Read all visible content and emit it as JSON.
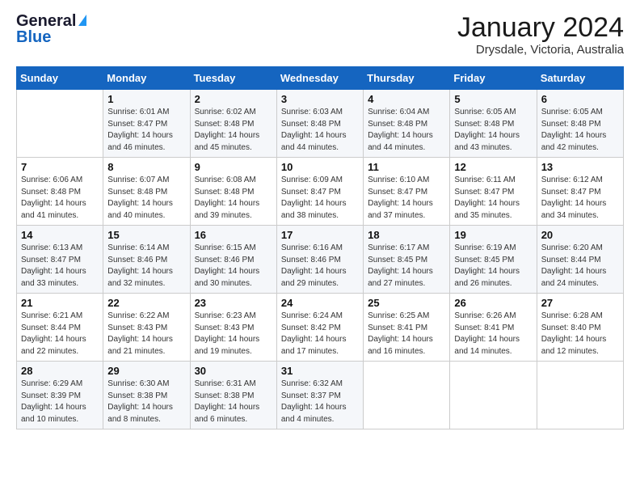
{
  "logo": {
    "line1": "General",
    "line2": "Blue"
  },
  "title": "January 2024",
  "location": "Drysdale, Victoria, Australia",
  "days_header": [
    "Sunday",
    "Monday",
    "Tuesday",
    "Wednesday",
    "Thursday",
    "Friday",
    "Saturday"
  ],
  "weeks": [
    [
      {
        "day": "",
        "info": ""
      },
      {
        "day": "1",
        "info": "Sunrise: 6:01 AM\nSunset: 8:47 PM\nDaylight: 14 hours\nand 46 minutes."
      },
      {
        "day": "2",
        "info": "Sunrise: 6:02 AM\nSunset: 8:48 PM\nDaylight: 14 hours\nand 45 minutes."
      },
      {
        "day": "3",
        "info": "Sunrise: 6:03 AM\nSunset: 8:48 PM\nDaylight: 14 hours\nand 44 minutes."
      },
      {
        "day": "4",
        "info": "Sunrise: 6:04 AM\nSunset: 8:48 PM\nDaylight: 14 hours\nand 44 minutes."
      },
      {
        "day": "5",
        "info": "Sunrise: 6:05 AM\nSunset: 8:48 PM\nDaylight: 14 hours\nand 43 minutes."
      },
      {
        "day": "6",
        "info": "Sunrise: 6:05 AM\nSunset: 8:48 PM\nDaylight: 14 hours\nand 42 minutes."
      }
    ],
    [
      {
        "day": "7",
        "info": "Sunrise: 6:06 AM\nSunset: 8:48 PM\nDaylight: 14 hours\nand 41 minutes."
      },
      {
        "day": "8",
        "info": "Sunrise: 6:07 AM\nSunset: 8:48 PM\nDaylight: 14 hours\nand 40 minutes."
      },
      {
        "day": "9",
        "info": "Sunrise: 6:08 AM\nSunset: 8:48 PM\nDaylight: 14 hours\nand 39 minutes."
      },
      {
        "day": "10",
        "info": "Sunrise: 6:09 AM\nSunset: 8:47 PM\nDaylight: 14 hours\nand 38 minutes."
      },
      {
        "day": "11",
        "info": "Sunrise: 6:10 AM\nSunset: 8:47 PM\nDaylight: 14 hours\nand 37 minutes."
      },
      {
        "day": "12",
        "info": "Sunrise: 6:11 AM\nSunset: 8:47 PM\nDaylight: 14 hours\nand 35 minutes."
      },
      {
        "day": "13",
        "info": "Sunrise: 6:12 AM\nSunset: 8:47 PM\nDaylight: 14 hours\nand 34 minutes."
      }
    ],
    [
      {
        "day": "14",
        "info": "Sunrise: 6:13 AM\nSunset: 8:47 PM\nDaylight: 14 hours\nand 33 minutes."
      },
      {
        "day": "15",
        "info": "Sunrise: 6:14 AM\nSunset: 8:46 PM\nDaylight: 14 hours\nand 32 minutes."
      },
      {
        "day": "16",
        "info": "Sunrise: 6:15 AM\nSunset: 8:46 PM\nDaylight: 14 hours\nand 30 minutes."
      },
      {
        "day": "17",
        "info": "Sunrise: 6:16 AM\nSunset: 8:46 PM\nDaylight: 14 hours\nand 29 minutes."
      },
      {
        "day": "18",
        "info": "Sunrise: 6:17 AM\nSunset: 8:45 PM\nDaylight: 14 hours\nand 27 minutes."
      },
      {
        "day": "19",
        "info": "Sunrise: 6:19 AM\nSunset: 8:45 PM\nDaylight: 14 hours\nand 26 minutes."
      },
      {
        "day": "20",
        "info": "Sunrise: 6:20 AM\nSunset: 8:44 PM\nDaylight: 14 hours\nand 24 minutes."
      }
    ],
    [
      {
        "day": "21",
        "info": "Sunrise: 6:21 AM\nSunset: 8:44 PM\nDaylight: 14 hours\nand 22 minutes."
      },
      {
        "day": "22",
        "info": "Sunrise: 6:22 AM\nSunset: 8:43 PM\nDaylight: 14 hours\nand 21 minutes."
      },
      {
        "day": "23",
        "info": "Sunrise: 6:23 AM\nSunset: 8:43 PM\nDaylight: 14 hours\nand 19 minutes."
      },
      {
        "day": "24",
        "info": "Sunrise: 6:24 AM\nSunset: 8:42 PM\nDaylight: 14 hours\nand 17 minutes."
      },
      {
        "day": "25",
        "info": "Sunrise: 6:25 AM\nSunset: 8:41 PM\nDaylight: 14 hours\nand 16 minutes."
      },
      {
        "day": "26",
        "info": "Sunrise: 6:26 AM\nSunset: 8:41 PM\nDaylight: 14 hours\nand 14 minutes."
      },
      {
        "day": "27",
        "info": "Sunrise: 6:28 AM\nSunset: 8:40 PM\nDaylight: 14 hours\nand 12 minutes."
      }
    ],
    [
      {
        "day": "28",
        "info": "Sunrise: 6:29 AM\nSunset: 8:39 PM\nDaylight: 14 hours\nand 10 minutes."
      },
      {
        "day": "29",
        "info": "Sunrise: 6:30 AM\nSunset: 8:38 PM\nDaylight: 14 hours\nand 8 minutes."
      },
      {
        "day": "30",
        "info": "Sunrise: 6:31 AM\nSunset: 8:38 PM\nDaylight: 14 hours\nand 6 minutes."
      },
      {
        "day": "31",
        "info": "Sunrise: 6:32 AM\nSunset: 8:37 PM\nDaylight: 14 hours\nand 4 minutes."
      },
      {
        "day": "",
        "info": ""
      },
      {
        "day": "",
        "info": ""
      },
      {
        "day": "",
        "info": ""
      }
    ]
  ]
}
